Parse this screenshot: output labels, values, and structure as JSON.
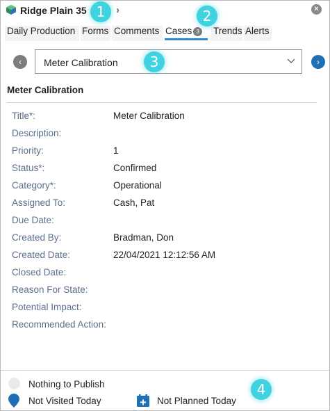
{
  "header": {
    "title": "Ridge Plain 35",
    "logo_icon": "cube-logo-icon",
    "next_icon": "chevron-right-icon",
    "close_icon": "close-icon"
  },
  "tabs": [
    {
      "label": "Daily Production"
    },
    {
      "label": "Forms"
    },
    {
      "label": "Comments"
    },
    {
      "label": "Cases",
      "badge": "3",
      "active": true
    },
    {
      "label": "Trends"
    },
    {
      "label": "Alerts"
    }
  ],
  "case_selector": {
    "value": "Meter Calibration",
    "prev_icon": "chevron-left-icon",
    "next_icon": "chevron-right-icon"
  },
  "section": {
    "title": "Meter Calibration"
  },
  "fields": [
    {
      "label": "Title*:",
      "value": "Meter Calibration"
    },
    {
      "label": "Description:",
      "value": ""
    },
    {
      "label": "Priority:",
      "value": "1"
    },
    {
      "label": "Status*:",
      "value": "Confirmed"
    },
    {
      "label": "Category*:",
      "value": "Operational"
    },
    {
      "label": "Assigned To:",
      "value": "Cash, Pat"
    },
    {
      "label": "Due Date:",
      "value": ""
    },
    {
      "label": "Created By:",
      "value": "Bradman, Don"
    },
    {
      "label": "Created Date:",
      "value": "22/04/2021 12:12:56 AM"
    },
    {
      "label": "Closed Date:",
      "value": ""
    },
    {
      "label": "Reason For State:",
      "value": ""
    },
    {
      "label": "Potential Impact:",
      "value": ""
    },
    {
      "label": "Recommended Action:",
      "value": ""
    }
  ],
  "footer": {
    "publish": "Nothing to Publish",
    "visited": "Not Visited Today",
    "planned": "Not Planned Today"
  },
  "callouts": [
    "1",
    "2",
    "3",
    "4"
  ],
  "colors": {
    "accent": "#2a8ad8",
    "next_button": "#1f6fb5",
    "label": "#5b6e8a",
    "callout": "#3fd2e0"
  }
}
